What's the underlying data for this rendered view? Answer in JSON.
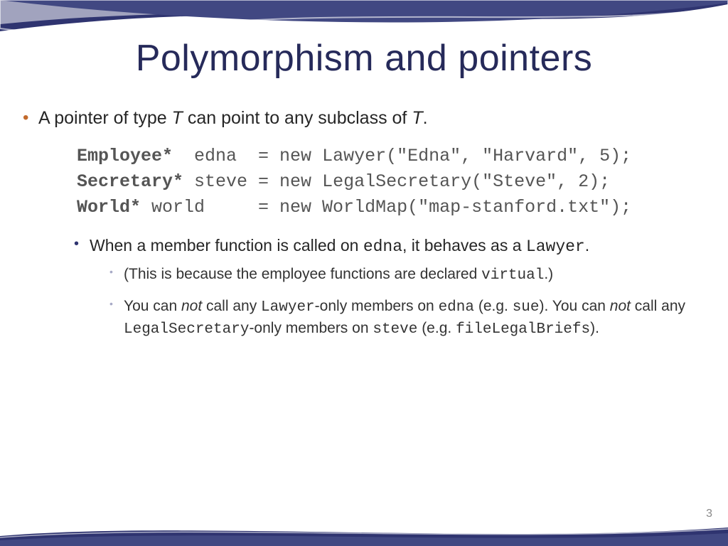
{
  "slide": {
    "title": "Polymorphism and pointers",
    "page_number": "3",
    "bullet1_pre": "A pointer of type ",
    "bullet1_T": "T",
    "bullet1_mid": "  can point to any subclass of ",
    "bullet1_T2": "T",
    "bullet1_post": ".",
    "code": {
      "l1_kw": "Employee*",
      "l1_rest": "  edna  = new Lawyer(\"Edna\", \"Harvard\", 5);",
      "l2_kw": "Secretary*",
      "l2_rest": " steve = new LegalSecretary(\"Steve\", 2);",
      "l3_kw": "World*",
      "l3_rest": " world     = new WorldMap(\"map-stanford.txt\");"
    },
    "sub1_pre": "When a member function is called on ",
    "sub1_code1": "edna",
    "sub1_mid": ", it behaves as a ",
    "sub1_code2": "Lawyer",
    "sub1_post": ".",
    "sub1a_pre": "(This is because the employee functions are declared ",
    "sub1a_code": "virtual",
    "sub1a_post": ".)",
    "sub1b_pre": "You can ",
    "sub1b_not": "not",
    "sub1b_mid1": " call any ",
    "sub1b_code1": "Lawyer",
    "sub1b_mid2": "-only members on ",
    "sub1b_code2": "edna",
    "sub1b_mid3": " (e.g. ",
    "sub1b_code3": "sue",
    "sub1b_mid4": "). You can ",
    "sub1b_not2": "not",
    "sub1b_mid5": " call any ",
    "sub1b_code4": "LegalSecretary",
    "sub1b_mid6": "-only members on ",
    "sub1b_code5": "steve",
    "sub1b_mid7": " (e.g. ",
    "sub1b_code6": "fileLegalBriefs",
    "sub1b_post": ")."
  }
}
